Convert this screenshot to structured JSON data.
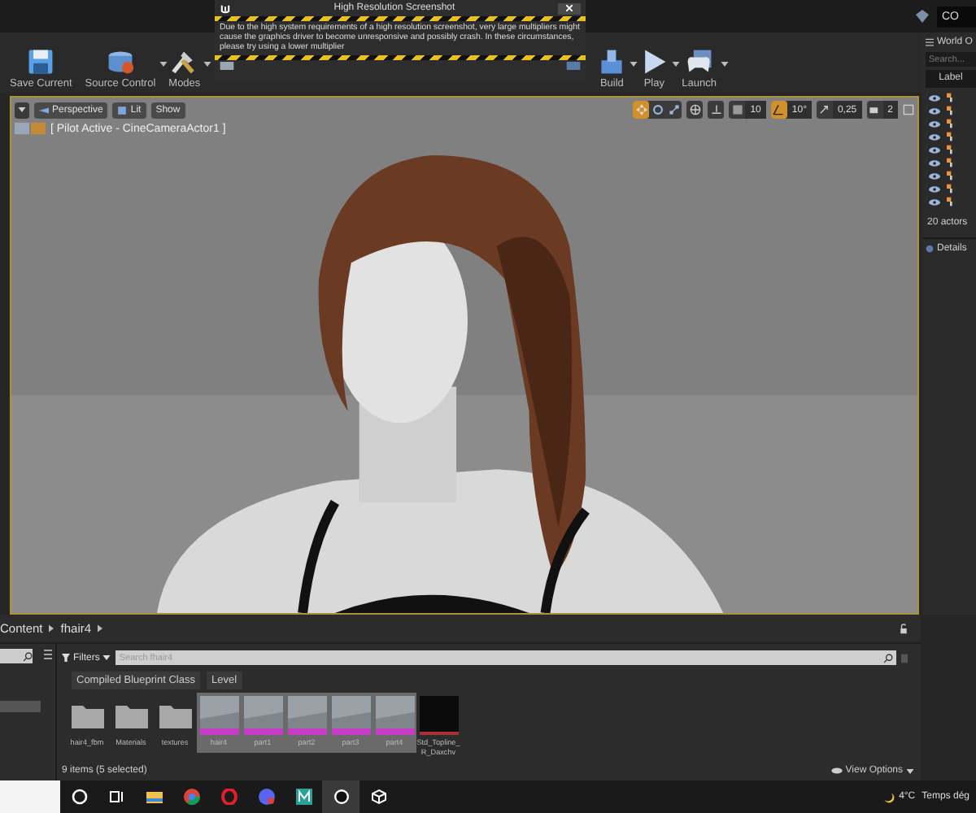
{
  "title_bar": {
    "account_button": "CO"
  },
  "toolbar": {
    "buttons": [
      {
        "label": "Save Current",
        "kind": "save",
        "caret": false
      },
      {
        "label": "Source Control",
        "kind": "source",
        "caret": true
      },
      {
        "label": "Modes",
        "kind": "modes",
        "caret": true
      },
      {
        "label": "Build",
        "kind": "build",
        "caret": true
      },
      {
        "label": "Play",
        "kind": "play",
        "caret": true
      },
      {
        "label": "Launch",
        "kind": "launch",
        "caret": true
      }
    ]
  },
  "notification": {
    "title": "High Resolution Screenshot",
    "message": "Due to the high system requirements of a high resolution screenshot, very large multipliers might cause the graphics driver to become unresponsive and possibly crash. In these circumstances, please try using a lower multiplier"
  },
  "viewport": {
    "view_buttons": [
      {
        "label": "Perspective",
        "kind": "perspective"
      },
      {
        "label": "Lit",
        "kind": "lit"
      },
      {
        "label": "Show",
        "kind": "plain"
      }
    ],
    "pilot_label": "[ Pilot Active - CineCameraActor1 ]",
    "translate_on": true,
    "grid_snap": {
      "on": false,
      "value": "10"
    },
    "rotation_snap": {
      "on": true,
      "value": "10°"
    },
    "scale_snap": {
      "on": false,
      "value": "0,25"
    },
    "camera_speed": "2"
  },
  "world_outliner": {
    "title": "World O",
    "search_placeholder": "Search...",
    "column": "Label",
    "actor_count": "20 actors"
  },
  "details": {
    "title": "Details"
  },
  "content_browser": {
    "path": [
      "Content",
      "fhair4"
    ],
    "filters_label": "Filters",
    "search_placeholder": "Search fhair4",
    "filter_chips": [
      "Compiled Blueprint Class",
      "Level"
    ],
    "assets": [
      {
        "name": "hair4_fbm",
        "kind": "folder",
        "selected": false
      },
      {
        "name": "Materials",
        "kind": "folder",
        "selected": false
      },
      {
        "name": "textures",
        "kind": "folder",
        "selected": false
      },
      {
        "name": "hair4",
        "kind": "level",
        "selected": true
      },
      {
        "name": "part1",
        "kind": "level",
        "selected": true
      },
      {
        "name": "part2",
        "kind": "level",
        "selected": true
      },
      {
        "name": "part3",
        "kind": "level",
        "selected": true
      },
      {
        "name": "part4",
        "kind": "level",
        "selected": true
      },
      {
        "name": "Std_Topline_R_Daxchv",
        "kind": "blueprint",
        "selected": false
      }
    ],
    "status": "9 items (5 selected)",
    "view_options": "View Options"
  },
  "taskbar": {
    "apps": [
      {
        "kind": "search",
        "active": false
      },
      {
        "kind": "taskview",
        "active": false
      },
      {
        "kind": "files",
        "active": false
      },
      {
        "kind": "chrome",
        "active": false
      },
      {
        "kind": "opera",
        "active": false
      },
      {
        "kind": "chat",
        "active": false
      },
      {
        "kind": "m-app",
        "active": false
      },
      {
        "kind": "unreal",
        "active": true
      },
      {
        "kind": "cube",
        "active": false
      }
    ],
    "weather_temp": "4°C",
    "weather_text": "Temps dég"
  }
}
